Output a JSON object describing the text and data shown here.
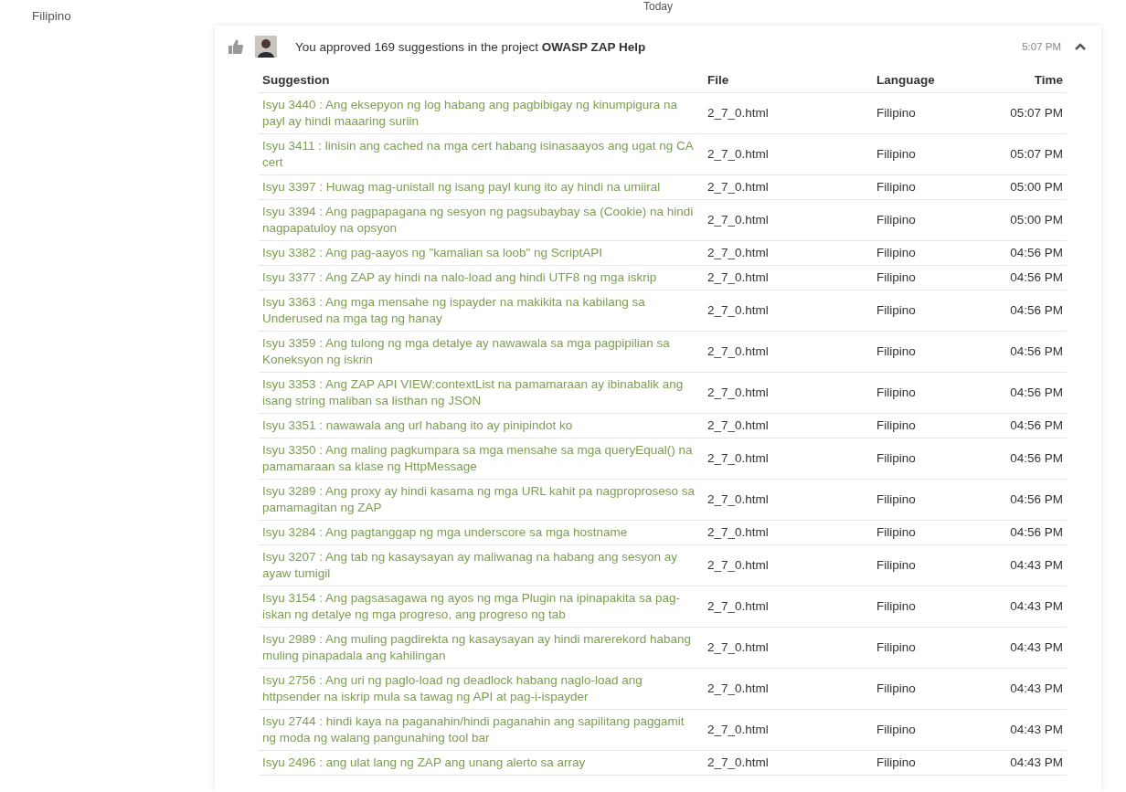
{
  "sidebar": {
    "language": "Filipino"
  },
  "day_heading": "Today",
  "activity": {
    "message": "You approved 169 suggestions in the project **OWASP ZAP Help**",
    "time": "5:07 PM",
    "expanded": true,
    "table": {
      "columns": [
        "Suggestion",
        "File",
        "Language",
        "Time"
      ],
      "rows": [
        {
          "suggestion": "Isyu 3440 : Ang eksepyon ng log habang ang pagbibigay ng kinumpigura na payl ay hindi maaaring suriin",
          "file": "2_7_0.html",
          "language": "Filipino",
          "time": "05:07 PM"
        },
        {
          "suggestion": "Isyu 3411 : linisin ang cached na mga cert habang isinasaayos ang ugat ng CA cert",
          "file": "2_7_0.html",
          "language": "Filipino",
          "time": "05:07 PM"
        },
        {
          "suggestion": "Isyu 3397 : Huwag mag-unistall ng isang payl kung ito ay hindi na umiiral",
          "file": "2_7_0.html",
          "language": "Filipino",
          "time": "05:00 PM"
        },
        {
          "suggestion": "Isyu 3394 : Ang pagpapagana ng sesyon ng pagsubaybay sa (Cookie) na hindi nagpapatuloy na opsyon",
          "file": "2_7_0.html",
          "language": "Filipino",
          "time": "05:00 PM"
        },
        {
          "suggestion": "Isyu 3382 : Ang pag-aayos ng \"kamalian sa loob\" ng ScriptAPI",
          "file": "2_7_0.html",
          "language": "Filipino",
          "time": "04:56 PM"
        },
        {
          "suggestion": "Isyu 3377 : Ang ZAP ay hindi na nalo-load ang hindi UTF8 ng mga iskrip",
          "file": "2_7_0.html",
          "language": "Filipino",
          "time": "04:56 PM"
        },
        {
          "suggestion": "Isyu 3363 : Ang mga mensahe ng ispayder na makikita na kabilang sa Underused na mga tag ng hanay",
          "file": "2_7_0.html",
          "language": "Filipino",
          "time": "04:56 PM"
        },
        {
          "suggestion": "Isyu 3359 : Ang tulong ng mga detalye ay nawawala sa mga pagpipilian sa Koneksyon ng iskrin",
          "file": "2_7_0.html",
          "language": "Filipino",
          "time": "04:56 PM"
        },
        {
          "suggestion": "Isyu 3353 : Ang ZAP API VIEW:contextList na pamamaraan ay ibinabalik ang isang string maliban sa listhan ng JSON",
          "file": "2_7_0.html",
          "language": "Filipino",
          "time": "04:56 PM"
        },
        {
          "suggestion": "Isyu 3351 : nawawala ang url habang ito ay pinipindot ko",
          "file": "2_7_0.html",
          "language": "Filipino",
          "time": "04:56 PM"
        },
        {
          "suggestion": "Isyu 3350 : Ang maling pagkumpara sa mga mensahe sa mga queryEqual() na pamamaraan sa klase ng HttpMessage",
          "file": "2_7_0.html",
          "language": "Filipino",
          "time": "04:56 PM"
        },
        {
          "suggestion": "Isyu 3289 : Ang proxy ay hindi kasama ng mga URL kahit pa nagproproseso sa pamamagitan ng ZAP",
          "file": "2_7_0.html",
          "language": "Filipino",
          "time": "04:56 PM"
        },
        {
          "suggestion": "Isyu 3284 : Ang pagtanggap ng mga underscore sa mga hostname",
          "file": "2_7_0.html",
          "language": "Filipino",
          "time": "04:56 PM"
        },
        {
          "suggestion": "Isyu 3207 : Ang tab ng kasaysayan ay maliwanag na habang ang sesyon ay ayaw tumigil",
          "file": "2_7_0.html",
          "language": "Filipino",
          "time": "04:43 PM"
        },
        {
          "suggestion": "Isyu 3154 : Ang pagsasagawa ng ayos ng mga Plugin na ipinapakita sa pag-iskan ng detalye ng mga progreso, ang progreso ng tab",
          "file": "2_7_0.html",
          "language": "Filipino",
          "time": "04:43 PM"
        },
        {
          "suggestion": "Isyu 2989 : Ang muling pagdirekta ng kasaysayan ay hindi marerekord habang muling pinapadala ang kahilingan",
          "file": "2_7_0.html",
          "language": "Filipino",
          "time": "04:43 PM"
        },
        {
          "suggestion": "Isyu 2756 : Ang uri ng paglo-load ng deadlock habang naglo-load ang httpsender na iskrip mula sa tawag ng API at pag-i-ispayder",
          "file": "2_7_0.html",
          "language": "Filipino",
          "time": "04:43 PM"
        },
        {
          "suggestion": "Isyu 2744 : hindi kaya na paganahin/hindi paganahin ang sapilitang paggamit ng moda ng walang pangunahing tool bar",
          "file": "2_7_0.html",
          "language": "Filipino",
          "time": "04:43 PM"
        },
        {
          "suggestion": "Isyu 2496 : ang ulat lang ng ZAP ang unang alerto sa array",
          "file": "2_7_0.html",
          "language": "Filipino",
          "time": "04:43 PM"
        }
      ]
    }
  }
}
